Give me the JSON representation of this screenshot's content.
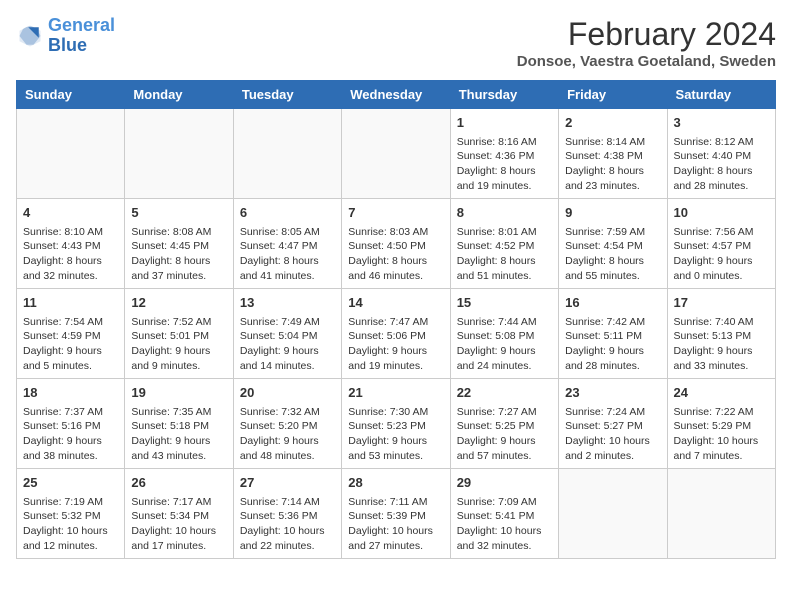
{
  "logo": {
    "name_part1": "General",
    "name_part2": "Blue"
  },
  "title": "February 2024",
  "subtitle": "Donsoe, Vaestra Goetaland, Sweden",
  "days_of_week": [
    "Sunday",
    "Monday",
    "Tuesday",
    "Wednesday",
    "Thursday",
    "Friday",
    "Saturday"
  ],
  "weeks": [
    [
      {
        "day": "",
        "info": ""
      },
      {
        "day": "",
        "info": ""
      },
      {
        "day": "",
        "info": ""
      },
      {
        "day": "",
        "info": ""
      },
      {
        "day": "1",
        "info": "Sunrise: 8:16 AM\nSunset: 4:36 PM\nDaylight: 8 hours\nand 19 minutes."
      },
      {
        "day": "2",
        "info": "Sunrise: 8:14 AM\nSunset: 4:38 PM\nDaylight: 8 hours\nand 23 minutes."
      },
      {
        "day": "3",
        "info": "Sunrise: 8:12 AM\nSunset: 4:40 PM\nDaylight: 8 hours\nand 28 minutes."
      }
    ],
    [
      {
        "day": "4",
        "info": "Sunrise: 8:10 AM\nSunset: 4:43 PM\nDaylight: 8 hours\nand 32 minutes."
      },
      {
        "day": "5",
        "info": "Sunrise: 8:08 AM\nSunset: 4:45 PM\nDaylight: 8 hours\nand 37 minutes."
      },
      {
        "day": "6",
        "info": "Sunrise: 8:05 AM\nSunset: 4:47 PM\nDaylight: 8 hours\nand 41 minutes."
      },
      {
        "day": "7",
        "info": "Sunrise: 8:03 AM\nSunset: 4:50 PM\nDaylight: 8 hours\nand 46 minutes."
      },
      {
        "day": "8",
        "info": "Sunrise: 8:01 AM\nSunset: 4:52 PM\nDaylight: 8 hours\nand 51 minutes."
      },
      {
        "day": "9",
        "info": "Sunrise: 7:59 AM\nSunset: 4:54 PM\nDaylight: 8 hours\nand 55 minutes."
      },
      {
        "day": "10",
        "info": "Sunrise: 7:56 AM\nSunset: 4:57 PM\nDaylight: 9 hours\nand 0 minutes."
      }
    ],
    [
      {
        "day": "11",
        "info": "Sunrise: 7:54 AM\nSunset: 4:59 PM\nDaylight: 9 hours\nand 5 minutes."
      },
      {
        "day": "12",
        "info": "Sunrise: 7:52 AM\nSunset: 5:01 PM\nDaylight: 9 hours\nand 9 minutes."
      },
      {
        "day": "13",
        "info": "Sunrise: 7:49 AM\nSunset: 5:04 PM\nDaylight: 9 hours\nand 14 minutes."
      },
      {
        "day": "14",
        "info": "Sunrise: 7:47 AM\nSunset: 5:06 PM\nDaylight: 9 hours\nand 19 minutes."
      },
      {
        "day": "15",
        "info": "Sunrise: 7:44 AM\nSunset: 5:08 PM\nDaylight: 9 hours\nand 24 minutes."
      },
      {
        "day": "16",
        "info": "Sunrise: 7:42 AM\nSunset: 5:11 PM\nDaylight: 9 hours\nand 28 minutes."
      },
      {
        "day": "17",
        "info": "Sunrise: 7:40 AM\nSunset: 5:13 PM\nDaylight: 9 hours\nand 33 minutes."
      }
    ],
    [
      {
        "day": "18",
        "info": "Sunrise: 7:37 AM\nSunset: 5:16 PM\nDaylight: 9 hours\nand 38 minutes."
      },
      {
        "day": "19",
        "info": "Sunrise: 7:35 AM\nSunset: 5:18 PM\nDaylight: 9 hours\nand 43 minutes."
      },
      {
        "day": "20",
        "info": "Sunrise: 7:32 AM\nSunset: 5:20 PM\nDaylight: 9 hours\nand 48 minutes."
      },
      {
        "day": "21",
        "info": "Sunrise: 7:30 AM\nSunset: 5:23 PM\nDaylight: 9 hours\nand 53 minutes."
      },
      {
        "day": "22",
        "info": "Sunrise: 7:27 AM\nSunset: 5:25 PM\nDaylight: 9 hours\nand 57 minutes."
      },
      {
        "day": "23",
        "info": "Sunrise: 7:24 AM\nSunset: 5:27 PM\nDaylight: 10 hours\nand 2 minutes."
      },
      {
        "day": "24",
        "info": "Sunrise: 7:22 AM\nSunset: 5:29 PM\nDaylight: 10 hours\nand 7 minutes."
      }
    ],
    [
      {
        "day": "25",
        "info": "Sunrise: 7:19 AM\nSunset: 5:32 PM\nDaylight: 10 hours\nand 12 minutes."
      },
      {
        "day": "26",
        "info": "Sunrise: 7:17 AM\nSunset: 5:34 PM\nDaylight: 10 hours\nand 17 minutes."
      },
      {
        "day": "27",
        "info": "Sunrise: 7:14 AM\nSunset: 5:36 PM\nDaylight: 10 hours\nand 22 minutes."
      },
      {
        "day": "28",
        "info": "Sunrise: 7:11 AM\nSunset: 5:39 PM\nDaylight: 10 hours\nand 27 minutes."
      },
      {
        "day": "29",
        "info": "Sunrise: 7:09 AM\nSunset: 5:41 PM\nDaylight: 10 hours\nand 32 minutes."
      },
      {
        "day": "",
        "info": ""
      },
      {
        "day": "",
        "info": ""
      }
    ]
  ]
}
